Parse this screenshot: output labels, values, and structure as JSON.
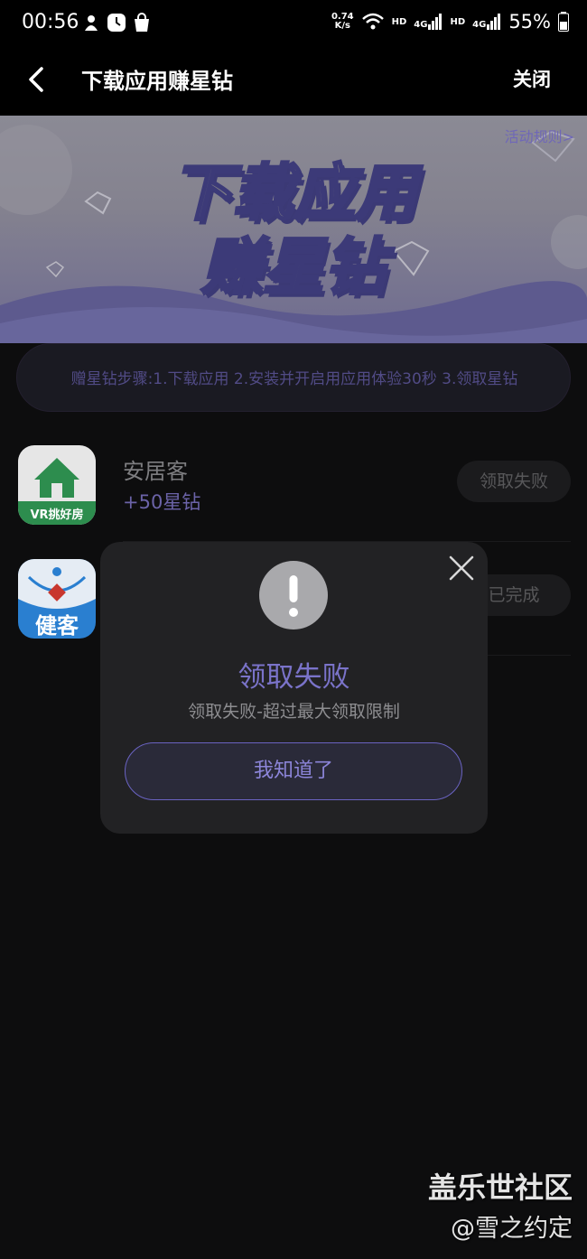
{
  "status_bar": {
    "time": "00:56",
    "net_speed_value": "0.74",
    "net_speed_unit": "K/s",
    "hd1": "HD",
    "sig1": "4G",
    "hd2": "HD",
    "sig2": "4G",
    "battery": "55%"
  },
  "header": {
    "title": "下载应用赚星钻",
    "close_label": "关闭"
  },
  "banner": {
    "line1": "下载应用",
    "line2": "赚星钻",
    "rules_link": "活动规则>"
  },
  "steps": {
    "text": "赠星钻步骤:1.下载应用 2.安装并开启用应用体验30秒 3.领取星钻"
  },
  "apps": [
    {
      "name": "安居客",
      "reward": "+50星钻",
      "button": "领取失败",
      "icon_caption": "VR挑好房"
    },
    {
      "name": "",
      "reward": "",
      "button": "已完成",
      "icon_caption": "健客"
    }
  ],
  "dialog": {
    "title": "领取失败",
    "message": "领取失败-超过最大领取限制",
    "confirm_label": "我知道了"
  },
  "watermark": {
    "line1": "盖乐世社区",
    "line2": "@雪之约定"
  },
  "colors": {
    "accent": "#7a73c9",
    "background": "#0d0d0e",
    "dialog_bg": "#222224"
  }
}
